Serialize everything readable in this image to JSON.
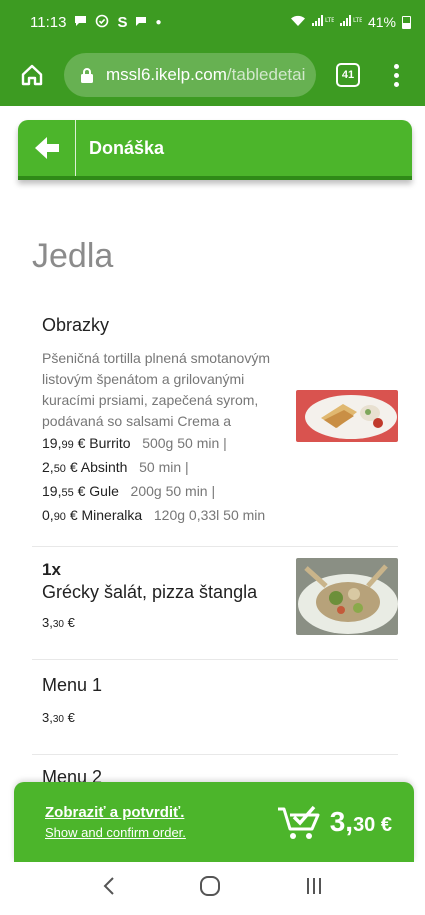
{
  "status_bar": {
    "time": "11:13",
    "battery": "41%",
    "notif_s": "S"
  },
  "browser": {
    "url_host": "mssl6.ikelp.com",
    "url_path": "/tabledetai",
    "tab_count": "41"
  },
  "header": {
    "title": "Donáška"
  },
  "section_title": "Jedla",
  "items": [
    {
      "name": "Obrazky",
      "description": "Pšeničná tortilla plnená smotanovým listovým špenátom a grilovanými kuracími prsiami, zapečená syrom, podávaná so salsami Crema a",
      "variants": [
        {
          "euros": "19,",
          "cents": "99",
          "label": " € Burrito",
          "meta": "500g   50 min   |"
        },
        {
          "euros": "2,",
          "cents": "50",
          "label": " € Absinth",
          "meta": "50 min   |"
        },
        {
          "euros": "19,",
          "cents": "55",
          "label": " € Gule",
          "meta": "200g   50 min   |"
        },
        {
          "euros": "0,",
          "cents": "90",
          "label": " € Mineralka",
          "meta": "120g   0,33l   50 min"
        }
      ]
    },
    {
      "qty": "1x",
      "name": "Grécky šalát, pizza štangla",
      "price_euros": "3,",
      "price_cents": "30",
      "price_symbol": " €"
    },
    {
      "name": "Menu 1",
      "price_euros": "3,",
      "price_cents": "30",
      "price_symbol": " €"
    },
    {
      "name": "Menu 2"
    }
  ],
  "order_bar": {
    "main": "Zobraziť a potvrdiť.",
    "sub": "Show and confirm order.",
    "total_euros": "3,",
    "total_cents": "30",
    "total_symbol": " €"
  },
  "colors": {
    "brand_green": "#3d9b22",
    "header_green": "#4cb52b"
  }
}
